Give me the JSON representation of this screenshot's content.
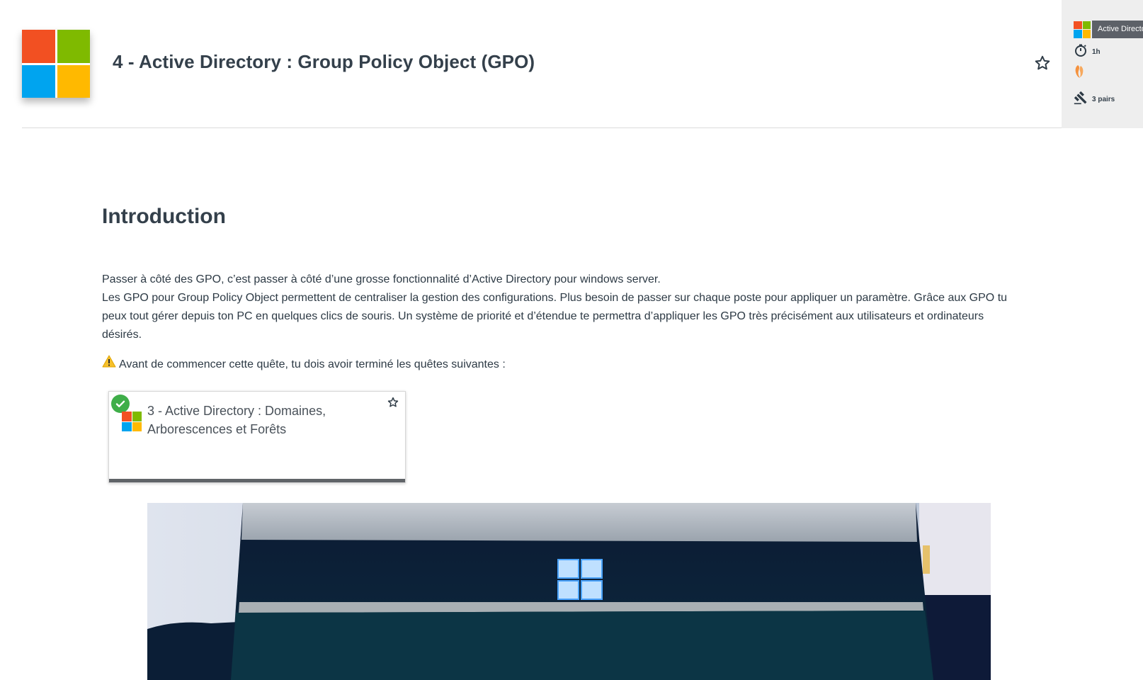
{
  "header": {
    "title": "4 - Active Directory : Group Policy Object (GPO)",
    "logo_icon": "microsoft-windows-logo",
    "favorite_icon": "star-outline-icon"
  },
  "side_panel": {
    "category_tag": "Active Directory",
    "duration": "1h",
    "peers": "3 pairs",
    "icons": [
      "microsoft-windows-logo",
      "stopwatch-icon",
      "orange-badge-icon",
      "gavel-icon"
    ]
  },
  "intro": {
    "heading": "Introduction",
    "paragraph_1": "Passer à côté des GPO, c’est passer à côté d’une grosse fonctionnalité d’Active Directory pour windows server.",
    "paragraph_2": "Les GPO pour Group Policy Object permettent de centraliser la gestion des configurations. Plus besoin de passer sur chaque poste pour appliquer un paramètre. Grâce aux GPO tu peux tout gérer depuis ton PC en quelques clics de souris. Un système de priorité et d’étendue te permettra d’appliquer les GPO très précisément aux utilisateurs et ordinateurs désirés.",
    "warning": "Avant de commencer cette quête, tu dois avoir terminé les quêtes suivantes :"
  },
  "prerequisite_card": {
    "title": "3 - Active Directory : Domaines, Arborescences et Forêts",
    "status": "completed",
    "icons": [
      "check-icon",
      "microsoft-windows-logo",
      "star-outline-icon"
    ]
  },
  "colors": {
    "ms_red": "#f25022",
    "ms_green": "#7fba00",
    "ms_blue": "#00a4ef",
    "ms_yellow": "#ffb900",
    "text": "#34404b",
    "check_green": "#3fae49",
    "tag_bg": "#5d6168",
    "side_bg": "#eeeeee"
  }
}
